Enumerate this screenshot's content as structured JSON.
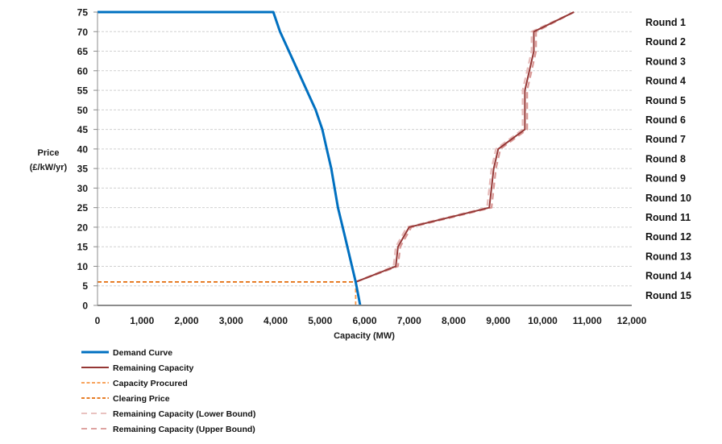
{
  "chart_data": {
    "type": "line",
    "title": "",
    "xlabel": "Capacity (MW)",
    "ylabel_lines": [
      "Price",
      "(£/kW/yr)"
    ],
    "xlim": [
      0,
      12000
    ],
    "ylim": [
      0,
      75
    ],
    "x_ticks": [
      0,
      1000,
      2000,
      3000,
      4000,
      5000,
      6000,
      7000,
      8000,
      9000,
      10000,
      11000,
      12000
    ],
    "x_tick_labels": [
      "0",
      "1,000",
      "2,000",
      "3,000",
      "4,000",
      "5,000",
      "6,000",
      "7,000",
      "8,000",
      "9,000",
      "10,000",
      "11,000",
      "12,000"
    ],
    "y_ticks": [
      0,
      5,
      10,
      15,
      20,
      25,
      30,
      35,
      40,
      45,
      50,
      55,
      60,
      65,
      70,
      75
    ],
    "y_tick_labels": [
      "0",
      "5",
      "10",
      "15",
      "20",
      "25",
      "30",
      "35",
      "40",
      "45",
      "50",
      "55",
      "60",
      "65",
      "70",
      "75"
    ],
    "grid": "horizontal-dashed",
    "legend_position": "bottom-left",
    "round_labels": [
      "Round 1",
      "Round 2",
      "Round 3",
      "Round 4",
      "Round 5",
      "Round 6",
      "Round 7",
      "Round 8",
      "Round 9",
      "Round 10",
      "Round 11",
      "Round 12",
      "Round 13",
      "Round 14",
      "Round 15"
    ],
    "series": [
      {
        "name": "Demand Curve",
        "color": "#0070C0",
        "style": "solid",
        "points": [
          [
            0,
            75
          ],
          [
            3950,
            75
          ],
          [
            4100,
            70
          ],
          [
            4500,
            60
          ],
          [
            4900,
            50
          ],
          [
            5050,
            45
          ],
          [
            5150,
            40
          ],
          [
            5250,
            35
          ],
          [
            5400,
            25
          ],
          [
            5550,
            18
          ],
          [
            5800,
            6
          ],
          [
            5900,
            0
          ]
        ]
      },
      {
        "name": "Remaining Capacity",
        "color": "#953735",
        "style": "solid",
        "points": [
          [
            5800,
            6
          ],
          [
            6700,
            10
          ],
          [
            6750,
            15
          ],
          [
            7000,
            20
          ],
          [
            8800,
            25
          ],
          [
            8900,
            35
          ],
          [
            9000,
            40
          ],
          [
            9600,
            45
          ],
          [
            9600,
            55
          ],
          [
            9800,
            65
          ],
          [
            9800,
            70
          ],
          [
            10700,
            75
          ]
        ]
      },
      {
        "name": "Capacity Procured",
        "color": "#F79646",
        "style": "dashed",
        "points": [
          [
            5800,
            0
          ],
          [
            5800,
            6
          ]
        ]
      },
      {
        "name": "Clearing Price",
        "color": "#E46C0A",
        "style": "dashed",
        "points": [
          [
            0,
            6
          ],
          [
            5800,
            6
          ]
        ]
      },
      {
        "name": "Remaining Capacity (Lower Bound)",
        "color": "#E6B9B8",
        "style": "long-dash",
        "points": [
          [
            5800,
            6
          ],
          [
            6650,
            10
          ],
          [
            6700,
            15
          ],
          [
            6950,
            20
          ],
          [
            8750,
            25
          ],
          [
            8850,
            35
          ],
          [
            8950,
            40
          ],
          [
            9550,
            45
          ],
          [
            9550,
            55
          ],
          [
            9750,
            65
          ],
          [
            9750,
            70
          ],
          [
            10700,
            75
          ]
        ]
      },
      {
        "name": "Remaining Capacity (Upper Bound)",
        "color": "#D99694",
        "style": "long-dash",
        "points": [
          [
            5800,
            6
          ],
          [
            6750,
            10
          ],
          [
            6800,
            15
          ],
          [
            7050,
            20
          ],
          [
            8850,
            25
          ],
          [
            8950,
            35
          ],
          [
            9050,
            40
          ],
          [
            9650,
            45
          ],
          [
            9650,
            55
          ],
          [
            9850,
            65
          ],
          [
            9850,
            70
          ],
          [
            10700,
            75
          ]
        ]
      }
    ]
  }
}
